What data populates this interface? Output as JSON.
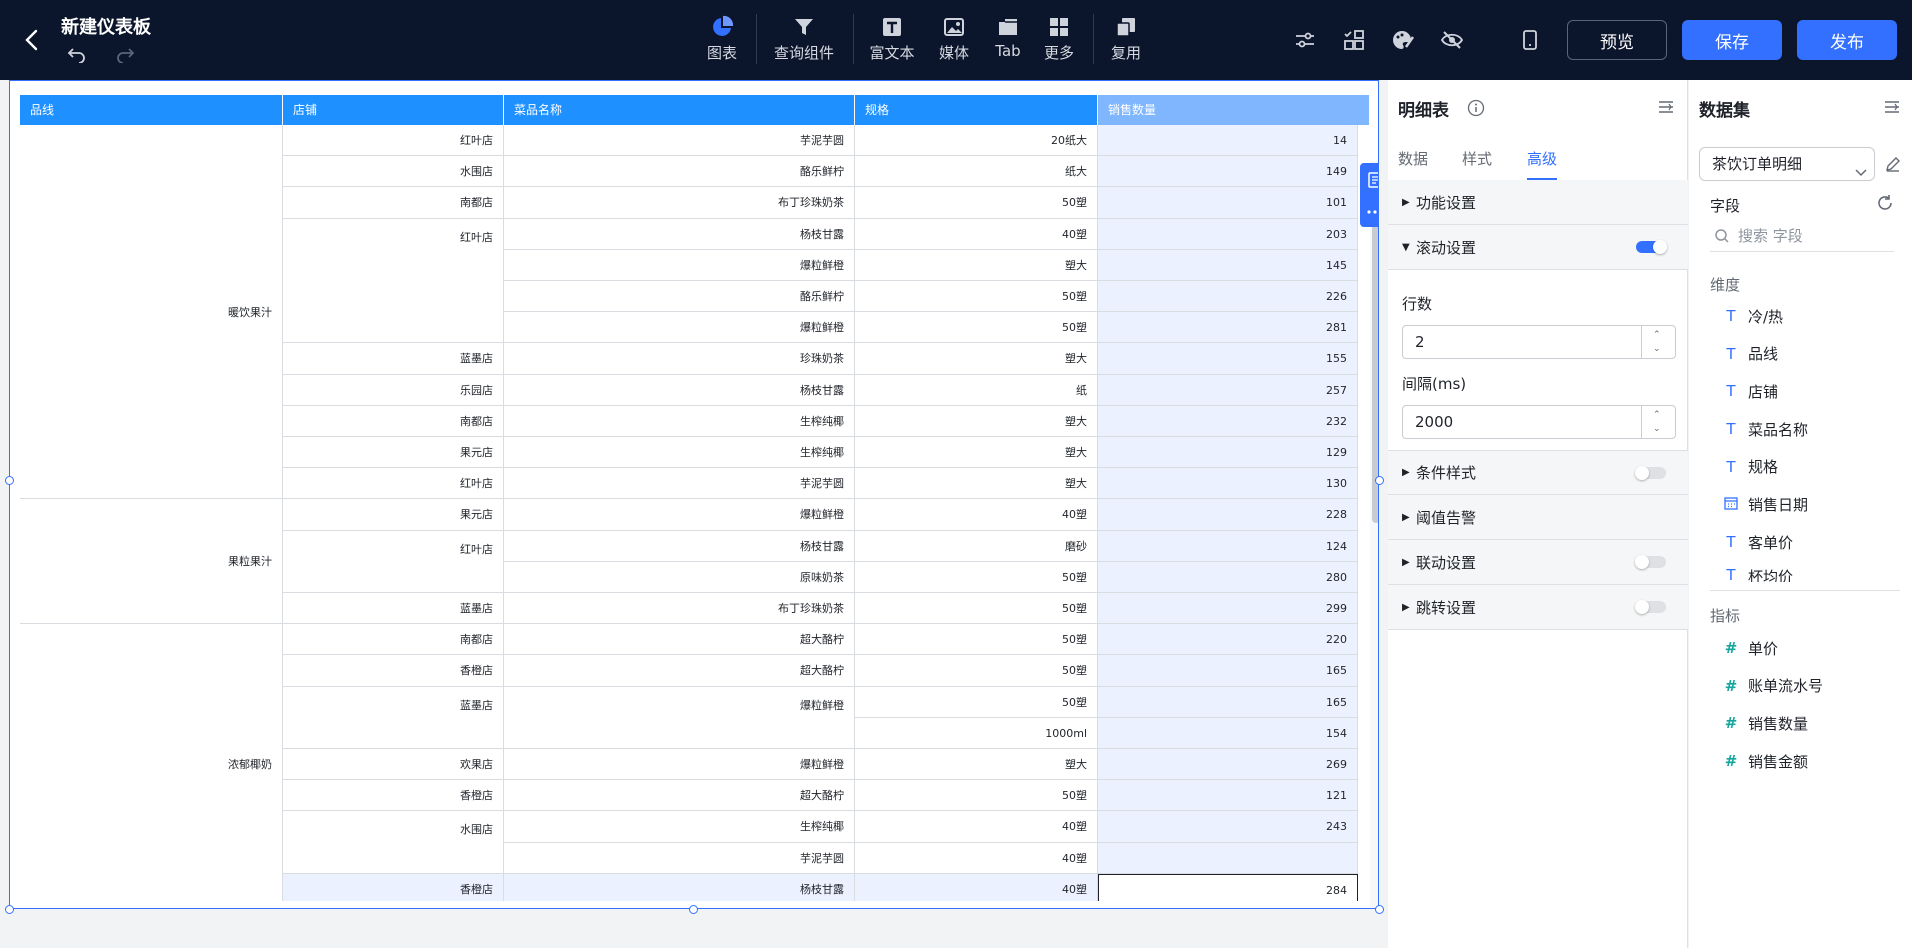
{
  "header": {
    "title": "新建仪表板",
    "tools": [
      {
        "label": "图表",
        "icon": "pie-chart-icon"
      },
      {
        "label": "查询组件",
        "icon": "filter-icon"
      },
      {
        "label": "富文本",
        "icon": "rich-text-icon"
      },
      {
        "label": "媒体",
        "icon": "image-icon"
      },
      {
        "label": "Tab",
        "icon": "tab-icon"
      },
      {
        "label": "更多",
        "icon": "grid-icon"
      },
      {
        "label": "复用",
        "icon": "copy-icon"
      }
    ],
    "preview_label": "预览",
    "save_label": "保存",
    "publish_label": "发布"
  },
  "table": {
    "columns": [
      "品线",
      "店铺",
      "菜品名称",
      "规格",
      "销售数量"
    ],
    "rows": [
      [
        "红叶店",
        "芋泥芋圆",
        "20纸大",
        "14"
      ],
      [
        "水围店",
        "酪乐鲜柠",
        "纸大",
        "149"
      ],
      [
        "南都店",
        "布丁珍珠奶茶",
        "50塑",
        "101"
      ],
      [
        "",
        "杨枝甘露",
        "40塑",
        "203"
      ],
      [
        "",
        "爆粒鲜橙",
        "塑大",
        "145"
      ],
      [
        "",
        "酪乐鲜柠",
        "50塑",
        "226"
      ],
      [
        "",
        "爆粒鲜橙",
        "50塑",
        "281"
      ],
      [
        "蓝墨店",
        "珍珠奶茶",
        "塑大",
        "155"
      ],
      [
        "乐园店",
        "杨枝甘露",
        "纸",
        "257"
      ],
      [
        "南都店",
        "生榨纯椰",
        "塑大",
        "232"
      ],
      [
        "果元店",
        "生榨纯椰",
        "塑大",
        "129"
      ],
      [
        "红叶店",
        "芋泥芋圆",
        "塑大",
        "130"
      ],
      [
        "果元店",
        "爆粒鲜橙",
        "40塑",
        "228"
      ],
      [
        "红叶店",
        "杨枝甘露",
        "磨砂",
        "124"
      ],
      [
        "",
        "原味奶茶",
        "50塑",
        "280"
      ],
      [
        "蓝墨店",
        "布丁珍珠奶茶",
        "50塑",
        "299"
      ],
      [
        "南都店",
        "超大酪柠",
        "50塑",
        "220"
      ],
      [
        "香橙店",
        "超大酪柠",
        "50塑",
        "165"
      ],
      [
        "蓝墨店",
        "爆粒鲜橙",
        "50塑",
        "165"
      ],
      [
        "",
        "",
        "1000ml",
        "154"
      ],
      [
        "欢果店",
        "爆粒鲜橙",
        "塑大",
        "269"
      ],
      [
        "香橙店",
        "超大酪柠",
        "50塑",
        "121"
      ],
      [
        "水围店",
        "生榨纯椰",
        "40塑",
        "243"
      ],
      [
        "",
        "芋泥芋圆",
        "40塑",
        ""
      ],
      [
        "香橙店",
        "杨枝甘露",
        "40塑",
        "284"
      ]
    ],
    "merged_store_red_leaf": "红叶店",
    "line_groups": [
      "暖饮果汁",
      "果粒果汁",
      "浓郁椰奶"
    ],
    "tooltip_value": "284"
  },
  "settings": {
    "title": "明细表",
    "tabs": [
      "数据",
      "样式",
      "高级"
    ],
    "sections": {
      "function": "功能设置",
      "scroll": "滚动设置",
      "condition": "条件样式",
      "threshold": "阈值告警",
      "linkage": "联动设置",
      "jump": "跳转设置"
    },
    "rows_label": "行数",
    "rows_value": "2",
    "interval_label": "间隔(ms)",
    "interval_value": "2000"
  },
  "dataset": {
    "title": "数据集",
    "selected": "茶饮订单明细",
    "field_title": "字段",
    "search_placeholder": "搜索 字段",
    "dimension_label": "维度",
    "dimensions": [
      {
        "name": "冷/热",
        "type": "text"
      },
      {
        "name": "品线",
        "type": "text"
      },
      {
        "name": "店铺",
        "type": "text"
      },
      {
        "name": "菜品名称",
        "type": "text"
      },
      {
        "name": "规格",
        "type": "text"
      },
      {
        "name": "销售日期",
        "type": "date"
      },
      {
        "name": "客单价",
        "type": "text"
      },
      {
        "name": "杯均价",
        "type": "text"
      }
    ],
    "measure_label": "指标",
    "measures": [
      "单价",
      "账单流水号",
      "销售数量",
      "销售金额"
    ]
  },
  "colors": {
    "accent": "#3370ff",
    "header_bg": "#0b152b",
    "table_header": "#1e90ff"
  }
}
